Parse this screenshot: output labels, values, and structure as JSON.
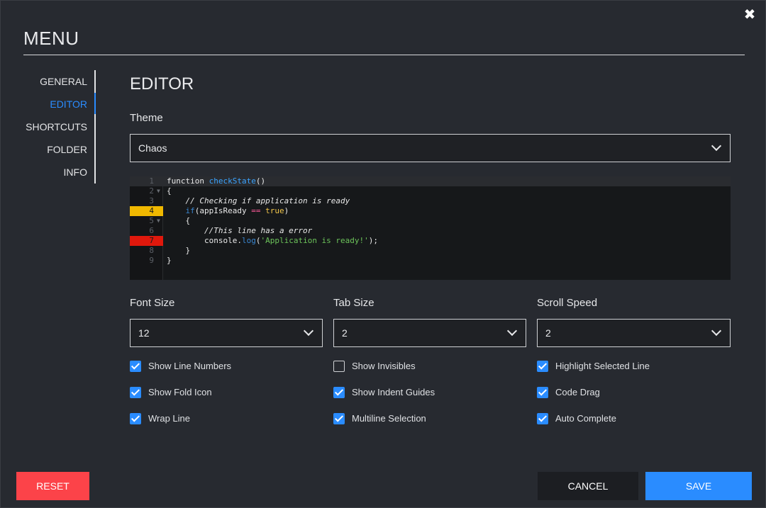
{
  "dialog": {
    "title": "MENU",
    "close_label": "✖"
  },
  "sidebar": {
    "items": [
      {
        "label": "GENERAL",
        "active": false
      },
      {
        "label": "EDITOR",
        "active": true
      },
      {
        "label": "SHORTCUTS",
        "active": false
      },
      {
        "label": "FOLDER",
        "active": false
      },
      {
        "label": "INFO",
        "active": false
      }
    ]
  },
  "editor_section": {
    "title": "EDITOR",
    "theme": {
      "label": "Theme",
      "value": "Chaos"
    },
    "preview": {
      "lines": [
        {
          "num": "1",
          "text": "function checkState()"
        },
        {
          "num": "2",
          "text": "{"
        },
        {
          "num": "3",
          "text": "    // Checking if application is ready"
        },
        {
          "num": "4",
          "text": "    if(appIsReady == true)"
        },
        {
          "num": "5",
          "text": "    {"
        },
        {
          "num": "6",
          "text": "        //This line has a error"
        },
        {
          "num": "7",
          "text": "        console.log('Application is ready!');"
        },
        {
          "num": "8",
          "text": "    }"
        },
        {
          "num": "9",
          "text": "}"
        }
      ],
      "colors": {
        "warning_marker": "#f0b800",
        "error_marker": "#e0180c"
      }
    },
    "font_size": {
      "label": "Font Size",
      "value": "12"
    },
    "tab_size": {
      "label": "Tab Size",
      "value": "2"
    },
    "scroll_speed": {
      "label": "Scroll Speed",
      "value": "2"
    },
    "options": {
      "show_line_numbers": {
        "label": "Show Line Numbers",
        "checked": true
      },
      "show_fold_icon": {
        "label": "Show Fold Icon",
        "checked": true
      },
      "wrap_line": {
        "label": "Wrap Line",
        "checked": true
      },
      "show_invisibles": {
        "label": "Show Invisibles",
        "checked": false
      },
      "show_indent_guides": {
        "label": "Show Indent Guides",
        "checked": true
      },
      "multiline_selection": {
        "label": "Multiline Selection",
        "checked": true
      },
      "highlight_selected_line": {
        "label": "Highlight Selected Line",
        "checked": true
      },
      "code_drag": {
        "label": "Code Drag",
        "checked": true
      },
      "auto_complete": {
        "label": "Auto Complete",
        "checked": true
      }
    }
  },
  "footer": {
    "reset_label": "RESET",
    "cancel_label": "CANCEL",
    "save_label": "SAVE"
  },
  "colors": {
    "accent": "#2a8cff",
    "danger": "#fc4349",
    "background": "#272a30"
  }
}
